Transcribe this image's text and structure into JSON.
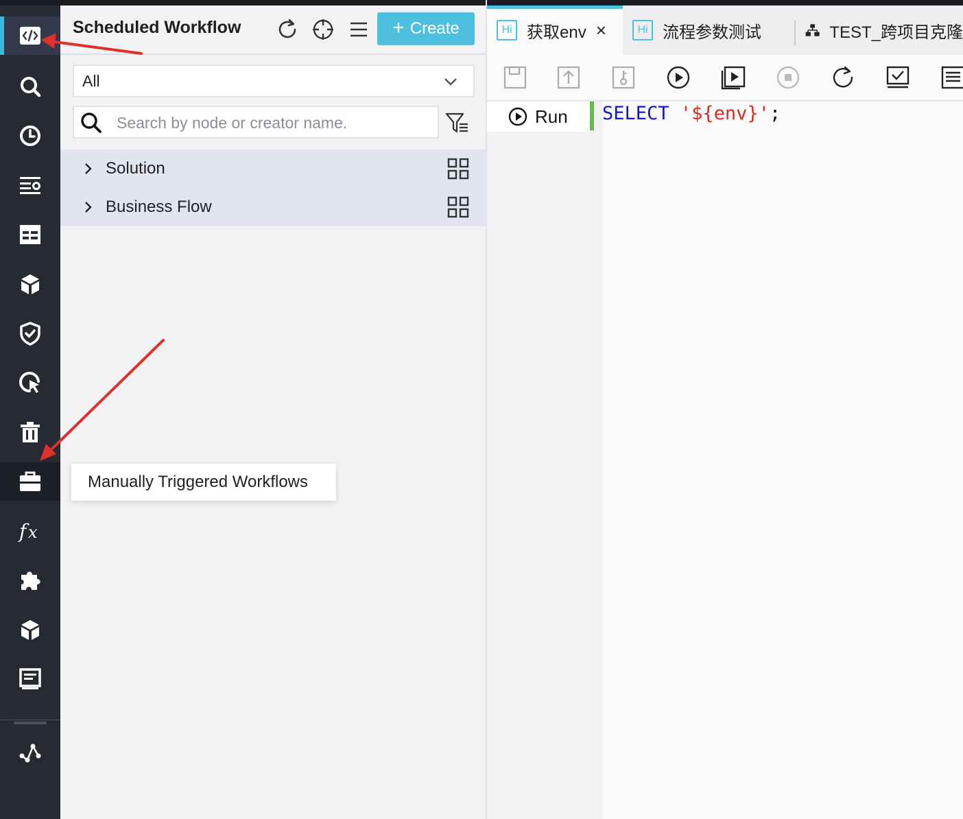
{
  "sidebar": {
    "title": "Scheduled Workflow",
    "create_label": "Create",
    "filter_selected": "All",
    "search_placeholder": "Search by node or creator name.",
    "tree": [
      {
        "label": "Solution"
      },
      {
        "label": "Business Flow"
      }
    ]
  },
  "rail": {
    "items": [
      "code-icon",
      "search-icon",
      "clock-icon",
      "list-settings-icon",
      "table-icon",
      "cube-icon",
      "shield-check-icon",
      "cursor-refresh-icon",
      "trash-icon",
      "briefcase-icon",
      "function-icon",
      "puzzle-icon",
      "cube-icon",
      "document-icon",
      "graph-icon"
    ],
    "active_index": 0,
    "hovered_index": 9
  },
  "tooltip": {
    "text": "Manually Triggered Workflows"
  },
  "tabs": [
    {
      "badge": "Hi",
      "label": "获取env",
      "active": true,
      "closable": true
    },
    {
      "badge": "Hi",
      "label": "流程参数测试",
      "active": false,
      "closable": false
    },
    {
      "icon": "flow-icon",
      "label": "TEST_跨项目克隆",
      "active": false,
      "closable": false
    }
  ],
  "editor": {
    "run_label": "Run",
    "code_keyword": "SELECT",
    "code_string": "'${env}'",
    "code_end": ";"
  },
  "colors": {
    "accent": "#4fbfe0",
    "rail_bg": "#262a33",
    "annotation": "#e0302a",
    "keyword": "#1414d2",
    "string": "#d92b1c",
    "run_marker": "#67bb4e"
  }
}
